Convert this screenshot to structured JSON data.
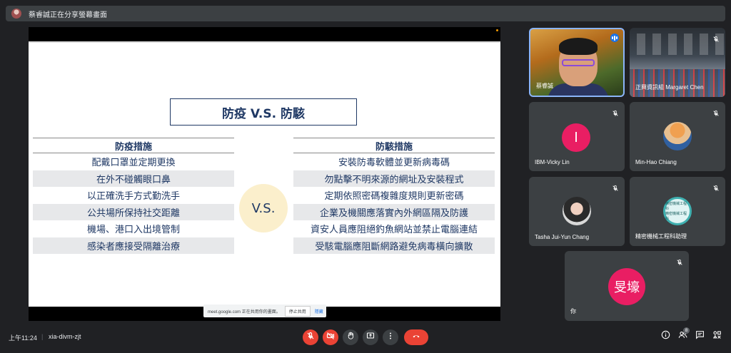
{
  "topbar": {
    "sharing_text": "蔡睿誠正在分享螢幕畫面"
  },
  "slide": {
    "title": "防疫 V.S. 防駭",
    "vs": "V.S.",
    "left": {
      "header": "防疫措施",
      "items": [
        "配戴口罩並定期更換",
        "在外不碰觸眼口鼻",
        "以正確洗手方式勤洗手",
        "公共場所保持社交距離",
        "機場、港口入出境管制",
        "感染者應接受隔離治療"
      ]
    },
    "right": {
      "header": "防駭措施",
      "items": [
        "安裝防毒軟體並更新病毒碼",
        "勿點擊不明來源的網址及安裝程式",
        "定期依照密碼複雜度規則更新密碼",
        "企業及機關應落實內外網區隔及防護",
        "資安人員應阻絕釣魚網站並禁止電腦連結",
        "受駭電腦應阻斷網路避免病毒橫向擴散"
      ]
    }
  },
  "share_banner": {
    "text": "meet.google.com 正在共用你的畫面。",
    "stop": "停止共用",
    "hide": "隱藏"
  },
  "participants": [
    {
      "name": "蔡睿誠",
      "speaking": true
    },
    {
      "name": "正興資訊組 Margaret Chen"
    },
    {
      "name": "IBM-Vicky Lin",
      "initial": "I",
      "color": "#e91e63",
      "muted": true
    },
    {
      "name": "Min-Hao Chiang",
      "muted": true
    },
    {
      "name": "Tasha Jui-Yun Chang",
      "muted": true
    },
    {
      "name": "精密機械工程科助理",
      "logo_text_top": "精密機械工程科",
      "logo_text_bottom": "精密機械工程科",
      "muted": true
    },
    {
      "name": "你",
      "initial": "旻壕",
      "color": "#e91e63",
      "muted": true
    }
  ],
  "bottombar": {
    "time": "上午11:24",
    "separator": "|",
    "meeting_code": "xia-divm-zjt",
    "people_count": "8"
  },
  "colors": {
    "mic_off_red": "#ea4335",
    "active_border": "#8ab4f8",
    "avatar_pink": "#e91e63"
  }
}
